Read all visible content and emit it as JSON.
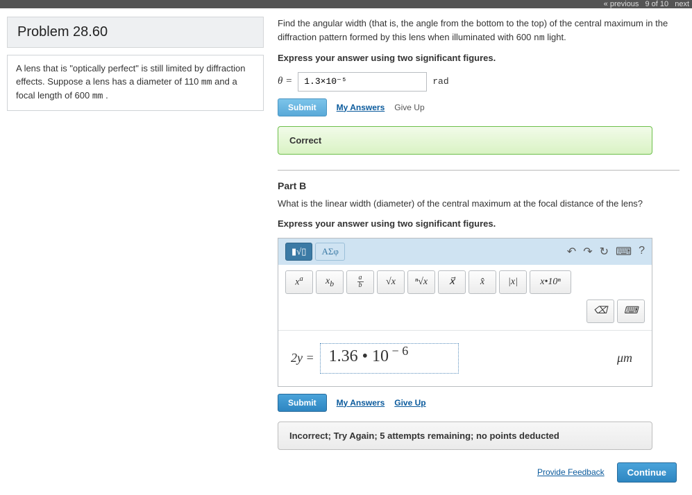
{
  "topnav": {
    "prev": "« previous",
    "progress": "9 of 10",
    "next": "next"
  },
  "problem": {
    "title": "Problem 28.60",
    "context_pre": "A lens that is \"optically perfect\" is still limited by diffraction effects. Suppose a lens has a diameter of 110 ",
    "context_unit1": "mm",
    "context_mid": " and a focal length of 600 ",
    "context_unit2": "mm",
    "context_post": " ."
  },
  "partA": {
    "prompt_pre": "Find the angular width (that is, the angle from the bottom to the top) of the central maximum in the diffraction pattern formed by this lens when illuminated with 600 ",
    "prompt_unit": "nm",
    "prompt_post": " light.",
    "instruct": "Express your answer using two significant figures.",
    "var": "θ =",
    "value": "1.3×10⁻⁵",
    "unit": "rad",
    "submit": "Submit",
    "my_answers": "My Answers",
    "give_up": "Give Up",
    "feedback": "Correct"
  },
  "partB": {
    "title": "Part B",
    "prompt": "What is the linear width (diameter) of the central maximum at the focal distance of the lens?",
    "instruct": "Express your answer using two significant figures.",
    "tabs": {
      "tmpl": "▮√▯",
      "greek": "ΑΣφ"
    },
    "tools": {
      "undo": "↶",
      "redo": "↷",
      "reset": "↻",
      "keyboard": "⌨",
      "help": "?"
    },
    "buttons": {
      "xa": "xᵃ",
      "xb": "xᵦ",
      "frac_a": "a",
      "frac_b": "b",
      "sqrt": "√x",
      "nroot": "ⁿ√x",
      "vec": "x⃗",
      "hat": "x̂",
      "abs": "|x|",
      "sci": "x•10ⁿ",
      "bksp": "⌫",
      "kbd": "⌨"
    },
    "var": "2y =",
    "value": "1.36 • 10",
    "exp": " − 6",
    "unit": "μm",
    "submit": "Submit",
    "my_answers": "My Answers",
    "give_up": "Give Up",
    "feedback": "Incorrect; Try Again; 5 attempts remaining; no points deducted"
  },
  "footer": {
    "feedback": "Provide Feedback",
    "continue": "Continue"
  }
}
